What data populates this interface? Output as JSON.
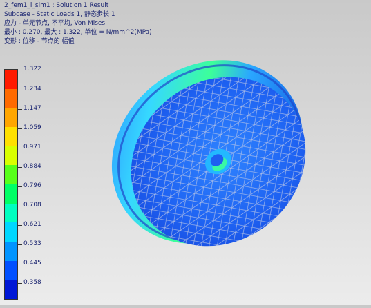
{
  "header": {
    "line1": "2_fem1_i_sim1 : Solution 1 Result",
    "line2": "Subcase - Static Loads 1, 静态步长 1",
    "line3": "应力 - 单元节点, 不平均, Von Mises",
    "line4": "最小 : 0.270, 最大 : 1.322, 单位 = N/mm^2(MPa)",
    "line5": "变形 : 位移 - 节点的 幅值"
  },
  "legend": {
    "values": [
      "1.322",
      "1.234",
      "1.147",
      "1.059",
      "0.971",
      "0.884",
      "0.796",
      "0.708",
      "0.621",
      "0.533",
      "0.445",
      "0.358"
    ],
    "colors": [
      "#ff1a00",
      "#ff6a00",
      "#ffa600",
      "#ffe000",
      "#d9ff00",
      "#57ff1a",
      "#00ff66",
      "#00ffc0",
      "#00d7ff",
      "#0094ff",
      "#0050ff",
      "#0018d6"
    ]
  }
}
